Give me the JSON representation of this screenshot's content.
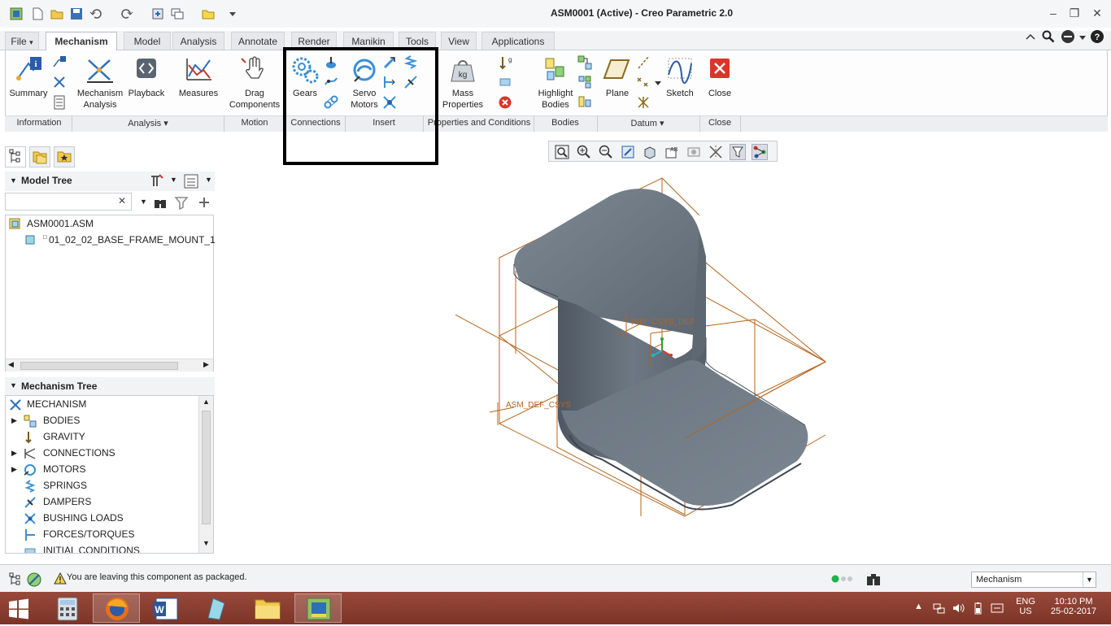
{
  "window": {
    "title": "ASM0001 (Active) - Creo Parametric 2.0"
  },
  "tabs": [
    {
      "label": "File",
      "dropdown": true
    },
    {
      "label": "Mechanism",
      "active": true
    },
    {
      "label": "Model"
    },
    {
      "label": "Analysis"
    },
    {
      "label": "Annotate"
    },
    {
      "label": "Render"
    },
    {
      "label": "Manikin"
    },
    {
      "label": "Tools"
    },
    {
      "label": "View"
    },
    {
      "label": "Applications"
    }
  ],
  "file_arrow": "▾",
  "ribbon": {
    "summary": "Summary",
    "mech_analysis_1": "Mechanism",
    "mech_analysis_2": "Analysis",
    "playback": "Playback",
    "measures": "Measures",
    "drag_1": "Drag",
    "drag_2": "Components",
    "gears": "Gears",
    "servo_1": "Servo",
    "servo_2": "Motors",
    "mass_1": "Mass",
    "mass_2": "Properties",
    "highlight_1": "Highlight",
    "highlight_2": "Bodies",
    "plane": "Plane",
    "sketch": "Sketch",
    "close": "Close",
    "groups": {
      "information": "Information",
      "analysis": "Analysis ▾",
      "motion": "Motion",
      "connections": "Connections",
      "insert": "Insert",
      "properties": "Properties and Conditions",
      "bodies": "Bodies",
      "datum": "Datum ▾",
      "close": "Close"
    }
  },
  "model_tree": {
    "header": "Model Tree",
    "search_clear": "✕",
    "items": [
      {
        "label": "ASM0001.ASM"
      },
      {
        "label": "01_02_02_BASE_FRAME_MOUNT_1"
      }
    ]
  },
  "mechanism_tree": {
    "header": "Mechanism Tree",
    "items": [
      {
        "label": "MECHANISM",
        "expandable": false
      },
      {
        "label": "BODIES",
        "expandable": true
      },
      {
        "label": "GRAVITY",
        "expandable": false
      },
      {
        "label": "CONNECTIONS",
        "expandable": true
      },
      {
        "label": "MOTORS",
        "expandable": true
      },
      {
        "label": "SPRINGS",
        "expandable": false
      },
      {
        "label": "DAMPERS",
        "expandable": false
      },
      {
        "label": "BUSHING LOADS",
        "expandable": false
      },
      {
        "label": "FORCES/TORQUES",
        "expandable": false
      },
      {
        "label": "INITIAL CONDITIONS",
        "expandable": false
      }
    ]
  },
  "viewport": {
    "csys_part": "PRT_CSYS_DEF",
    "csys_asm": "ASM_DEF_CSYS",
    "part_color": "#6f7984",
    "datum_color": "#b5651d"
  },
  "status": {
    "message": "You are leaving this component as packaged.",
    "mode": "Mechanism"
  },
  "taskbar": {
    "lang": "ENG",
    "region": "US",
    "time": "10:10 PM",
    "date": "25-02-2017"
  }
}
